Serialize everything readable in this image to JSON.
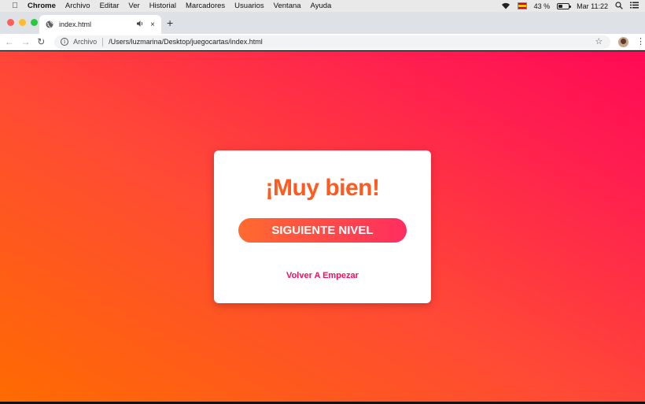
{
  "menubar": {
    "app_name": "Chrome",
    "items": [
      "Archivo",
      "Editar",
      "Ver",
      "Historial",
      "Marcadores",
      "Usuarios",
      "Ventana",
      "Ayuda"
    ],
    "battery_percent": "43 %",
    "battery_level": 0.43,
    "clock": "Mar 11:22"
  },
  "window": {
    "traffic_colors": [
      "#ff5f57",
      "#febc2e",
      "#28c840"
    ]
  },
  "tab": {
    "title": "index.html",
    "audio_icon": "speaker-icon",
    "close_label": "×"
  },
  "toolbar": {
    "scheme_label": "Archivo",
    "url": "/Users/luzmarina/Desktop/juegocartas/index.html"
  },
  "page": {
    "heading": "¡Muy bien!",
    "next_button": "SIGUIENTE NIVEL",
    "restart_link": "Volver A Empezar",
    "colors": {
      "heading": "#ff5a1f",
      "link": "#f0125a",
      "gradient_start": "#ff6b00",
      "gradient_end": "#ff0a55"
    }
  }
}
